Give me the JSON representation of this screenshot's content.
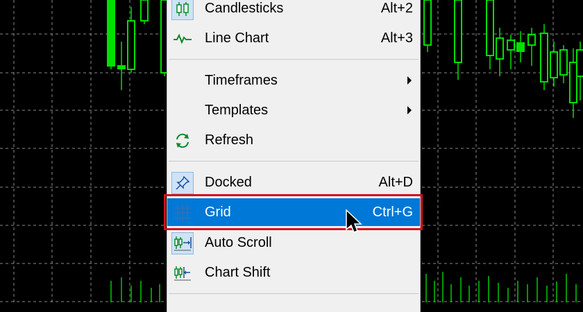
{
  "menu": {
    "items": [
      {
        "id": "candlesticks",
        "label": "Candlesticks",
        "shortcut": "Alt+2",
        "icon": "candlesticks-icon",
        "checked": true
      },
      {
        "id": "line-chart",
        "label": "Line Chart",
        "shortcut": "Alt+3",
        "icon": "line-chart-icon",
        "checked": false
      },
      {
        "id": "timeframes",
        "label": "Timeframes",
        "submenu": true
      },
      {
        "id": "templates",
        "label": "Templates",
        "submenu": true
      },
      {
        "id": "refresh",
        "label": "Refresh",
        "icon": "refresh-icon"
      },
      {
        "id": "docked",
        "label": "Docked",
        "shortcut": "Alt+D",
        "icon": "pin-icon",
        "checked": true
      },
      {
        "id": "grid",
        "label": "Grid",
        "shortcut": "Ctrl+G",
        "icon": "grid-icon",
        "checked": true,
        "highlighted": true
      },
      {
        "id": "auto-scroll",
        "label": "Auto Scroll",
        "icon": "auto-scroll-icon",
        "checked": true
      },
      {
        "id": "chart-shift",
        "label": "Chart Shift",
        "icon": "chart-shift-icon",
        "checked": false
      }
    ]
  },
  "colors": {
    "chart_background": "#000000",
    "grid": "#8a8a8a",
    "candle": "#00e000",
    "menu_background": "#f0f0f0",
    "highlight": "#0078d7",
    "annotation_box": "#d40f1c"
  }
}
